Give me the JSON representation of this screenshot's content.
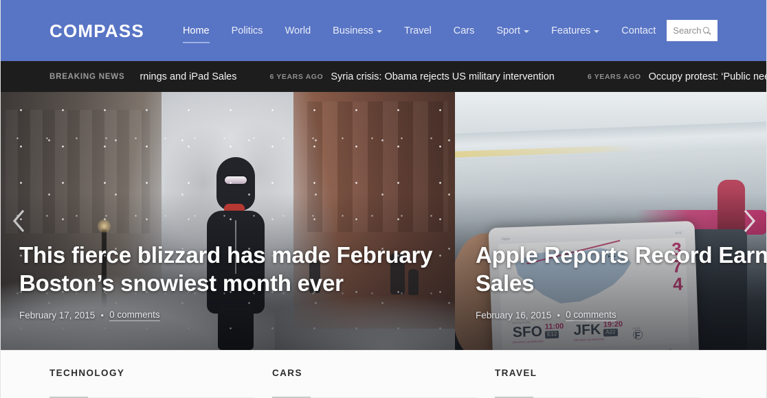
{
  "header": {
    "logo": "COMPASS",
    "nav": [
      {
        "label": "Home",
        "active": true,
        "dropdown": false
      },
      {
        "label": "Politics",
        "active": false,
        "dropdown": false
      },
      {
        "label": "World",
        "active": false,
        "dropdown": false
      },
      {
        "label": "Business",
        "active": false,
        "dropdown": true
      },
      {
        "label": "Travel",
        "active": false,
        "dropdown": false
      },
      {
        "label": "Cars",
        "active": false,
        "dropdown": false
      },
      {
        "label": "Sport",
        "active": false,
        "dropdown": true
      },
      {
        "label": "Features",
        "active": false,
        "dropdown": true
      },
      {
        "label": "Contact",
        "active": false,
        "dropdown": false
      }
    ],
    "search": {
      "placeholder": "Search ...",
      "value": "",
      "icon": "search-icon"
    },
    "bg_color": "#5874c4",
    "text_color": "#ffffff"
  },
  "ticker": {
    "label": "BREAKING NEWS",
    "bg_color": "#1d1d1d",
    "items": [
      {
        "time": "",
        "title": "rnings and iPad Sales"
      },
      {
        "time": "6 YEARS AGO",
        "title": "Syria crisis: Obama rejects US military intervention"
      },
      {
        "time": "6 YEARS AGO",
        "title": "Occupy protest: ‘Public needs educating’"
      }
    ]
  },
  "slider": {
    "prev_icon": "chevron-left-icon",
    "next_icon": "chevron-right-icon",
    "slides": [
      {
        "title": "This fierce blizzard has made February Boston’s snowiest month ever",
        "date": "February 17, 2015",
        "separator": "•",
        "comments": "0 comments",
        "image_alt": "person walking through heavy snowstorm on a city street"
      },
      {
        "title_line1": "Apple Reports Record Earnings a",
        "title_line2": "Sales",
        "date": "February 16, 2015",
        "separator": "•",
        "comments": "0 comments",
        "image_alt": "airplane cabin interior with hand holding an iPad showing a flight map",
        "ipad": {
          "departure_label": "DEPARTURE",
          "departure_code": "SFO",
          "departure_time": "11:00",
          "departure_gate": "E12",
          "departure_sub": "DELAYED 120 MINUTES",
          "arrival_label": "ARRIVAL",
          "arrival_code": "JFK",
          "arrival_time": "19:20",
          "arrival_gate": "A22",
          "arrival_sub": "DELAYED 110 MINUTES",
          "gate_label": "GATE",
          "big_numbers": [
            "3",
            "7",
            "4"
          ],
          "top_left": "Flights",
          "top_right": "11:02"
        }
      }
    ]
  },
  "categories": [
    {
      "title": "TECHNOLOGY"
    },
    {
      "title": "CARS"
    },
    {
      "title": "TRAVEL"
    }
  ],
  "colors": {
    "brand_blue": "#5874c4",
    "ticker_dark": "#1d1d1d",
    "page_bg": "#fbfbfb",
    "accent_underline": "#9db2e8"
  }
}
